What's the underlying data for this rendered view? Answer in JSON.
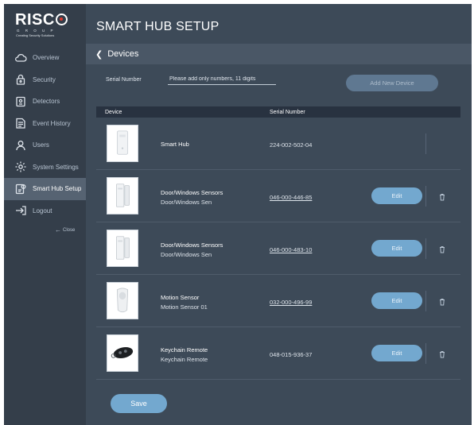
{
  "brand": {
    "name": "RISC",
    "subtitle": "G R O U P",
    "tagline": "Creating Security Solutions"
  },
  "sidebar": {
    "items": [
      {
        "label": "Overview",
        "icon": "cloud-icon"
      },
      {
        "label": "Security",
        "icon": "lock-icon"
      },
      {
        "label": "Detectors",
        "icon": "detector-icon"
      },
      {
        "label": "Event History",
        "icon": "history-icon"
      },
      {
        "label": "Users",
        "icon": "user-icon"
      },
      {
        "label": "System Settings",
        "icon": "gear-icon"
      },
      {
        "label": "Smart Hub Setup",
        "icon": "hub-setup-icon",
        "active": true
      },
      {
        "label": "Logout",
        "icon": "logout-icon"
      }
    ],
    "close_label": "Close"
  },
  "header": {
    "title": "SMART HUB SETUP",
    "section": "Devices"
  },
  "form": {
    "serial_label": "Serial Number",
    "serial_placeholder": "Please add only numbers, 11 digits",
    "add_button": "Add New Device"
  },
  "table": {
    "columns": [
      "Device",
      "Serial Number"
    ],
    "rows": [
      {
        "name": "Smart Hub",
        "subname": "",
        "serial": "224-002-502-04",
        "editable": false
      },
      {
        "name": "Door/Windows Sensors",
        "subname": "Door/Windows Sen",
        "serial": "046-000-446-85",
        "editable": true,
        "edit_label": "Edit"
      },
      {
        "name": "Door/Windows Sensors",
        "subname": "Door/Windows Sen",
        "serial": "046-000-483-10",
        "editable": true,
        "edit_label": "Edit"
      },
      {
        "name": "Motion Sensor",
        "subname": "Motion Sensor 01",
        "serial": "032-000-496-99",
        "editable": true,
        "edit_label": "Edit"
      },
      {
        "name": "Keychain Remote",
        "subname": "Keychain Remote",
        "serial": "048-015-936-37",
        "editable": true,
        "edit_label": "Edit"
      }
    ]
  },
  "footer": {
    "save_label": "Save"
  },
  "colors": {
    "background": "#3d4a58",
    "sidebar": "#343e4a",
    "accent": "#73a8cf",
    "brand_red": "#e03a2f"
  }
}
